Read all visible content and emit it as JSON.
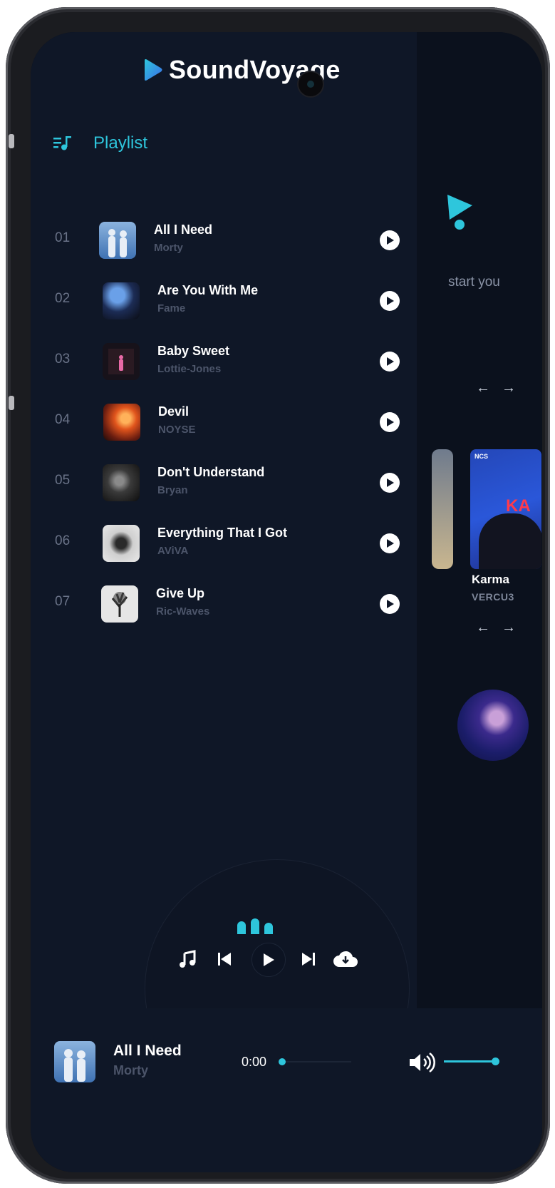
{
  "app": {
    "name": "SoundVoyage"
  },
  "background_page": {
    "tagline_partial": "start you",
    "featured_card": {
      "title": "Karma",
      "artist": "VERCU3",
      "cover_label": "NCS",
      "cover_text": "KA"
    }
  },
  "playlist": {
    "title": "Playlist",
    "tracks": [
      {
        "num": "01",
        "title": "All I Need",
        "artist": "Morty",
        "cover": "twins-silhouette"
      },
      {
        "num": "02",
        "title": "Are You With Me",
        "artist": "Fame",
        "cover": "blue-ghost"
      },
      {
        "num": "03",
        "title": "Baby Sweet",
        "artist": "Lottie-Jones",
        "cover": "pink-figure"
      },
      {
        "num": "04",
        "title": "Devil",
        "artist": "NOYSE",
        "cover": "orange-fire"
      },
      {
        "num": "05",
        "title": "Don't Understand",
        "artist": "Bryan",
        "cover": "dark-collage"
      },
      {
        "num": "06",
        "title": "Everything That I Got",
        "artist": "AViVA",
        "cover": "white-sketch"
      },
      {
        "num": "07",
        "title": "Give Up",
        "artist": "Ric-Waves",
        "cover": "tree-sketch"
      }
    ]
  },
  "now_playing": {
    "title": "All I Need",
    "artist": "Morty",
    "time": "0:00",
    "progress": 0.0,
    "volume": 1.0
  },
  "colors": {
    "accent": "#2ec6dc",
    "drawer_bg": "#0f1727",
    "page_bg": "#0b111d"
  },
  "icons": {
    "logo": "play-triangle-icon",
    "playlist": "playlist-music-icon",
    "arrows": [
      "arrow-left-icon",
      "arrow-right-icon"
    ],
    "controls": [
      "music-note-icon",
      "skip-previous-icon",
      "play-icon",
      "skip-next-icon",
      "cloud-download-icon"
    ],
    "volume": "volume-high-icon"
  }
}
